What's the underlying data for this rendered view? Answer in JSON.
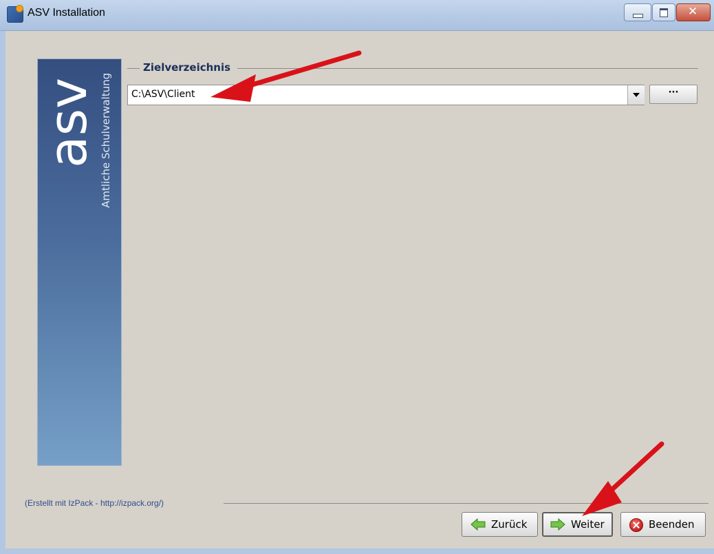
{
  "window": {
    "title": "ASV Installation",
    "close_glyph": "✕"
  },
  "banner": {
    "logo_text": "asv",
    "tagline": "Amtliche Schulverwaltung"
  },
  "target_dir": {
    "group_title": "Zielverzeichnis",
    "path_value": "C:\\ASV\\Client",
    "browse_label": "···"
  },
  "footer": {
    "credit": "(Erstellt mit IzPack - http://izpack.org/)"
  },
  "buttons": {
    "back_label": "Zurück",
    "next_label": "Weiter",
    "quit_label": "Beenden"
  },
  "icons": {
    "app": "installer-app-icon",
    "dropdown": "chevron-down-icon",
    "back": "arrow-left-icon",
    "next": "arrow-right-icon",
    "quit": "stop-icon"
  },
  "colors": {
    "banner_top": "#344e80",
    "banner_bottom": "#76a0c8",
    "annotation_arrow": "#d9121a",
    "arrow_icon_green": "#5cb83a"
  }
}
